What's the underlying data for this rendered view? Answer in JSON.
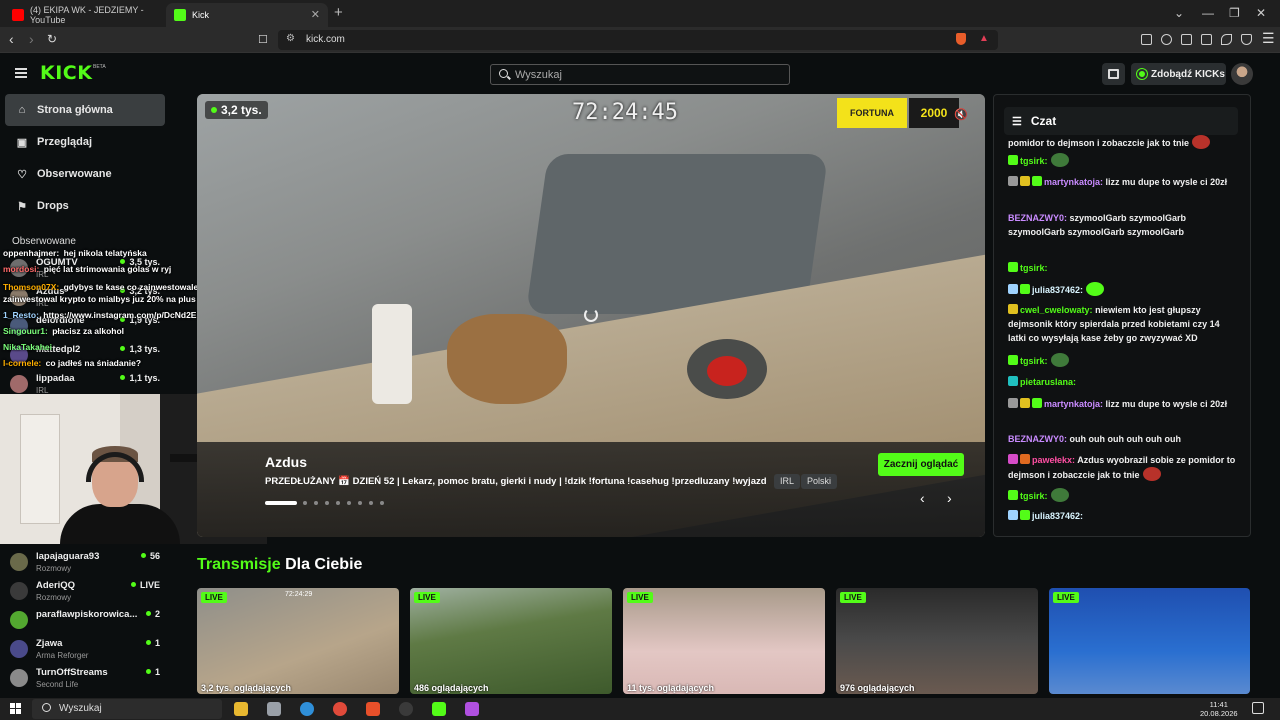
{
  "browser": {
    "tabs": [
      {
        "label": "(4) EKIPA WK - JEDZIEMY - YouTube"
      },
      {
        "label": "Kick"
      }
    ],
    "url": "kick.com"
  },
  "header": {
    "logo": "KICK",
    "beta": "BETA",
    "search_placeholder": "Wyszukaj",
    "kicks_button": "Zdobądź KICKs"
  },
  "sidebar": {
    "nav": [
      {
        "label": "Strona główna",
        "icon": "home-icon"
      },
      {
        "label": "Przeglądaj",
        "icon": "browse-icon"
      },
      {
        "label": "Obserwowane",
        "icon": "heart-icon"
      },
      {
        "label": "Drops",
        "icon": "drops-icon"
      }
    ],
    "followed_title": "Obserwowane",
    "channels_top": [
      {
        "name": "OGUMTV",
        "category": "IRL",
        "viewers": "3,5 tys."
      },
      {
        "name": "Azdus",
        "category": "IRL",
        "viewers": "3,2 tys."
      },
      {
        "name": "delordione",
        "category": "",
        "viewers": "1,9 tys."
      },
      {
        "name": "Mattedpl2",
        "category": "",
        "viewers": "1,3 tys."
      },
      {
        "name": "lippadaa",
        "category": "IRL",
        "viewers": "1,1 tys."
      }
    ],
    "channels_bottom": [
      {
        "name": "lapajaguara93",
        "category": "Rozmowy",
        "viewers": "56"
      },
      {
        "name": "AderiQQ",
        "category": "Rozmowy",
        "viewers": "LIVE"
      },
      {
        "name": "paraflawpiskorowica...",
        "category": "",
        "viewers": "2"
      },
      {
        "name": "Zjawa",
        "category": "Arma Reforger",
        "viewers": "1"
      },
      {
        "name": "TurnOffStreams",
        "category": "Second Life",
        "viewers": "1"
      }
    ]
  },
  "overlay_chat": [
    {
      "user": "oppenhajmer:",
      "text": "hej nikola telatyńska",
      "color": "#ffffff"
    },
    {
      "user": "mordosi:",
      "text": "pięć lat strimowania golas w ryj",
      "color": "#ff6b6b"
    },
    {
      "user": "Thomson07X:",
      "text": "gdybys te kase co zainwestowales yomis",
      "color": "#ffb000"
    },
    {
      "user": "",
      "text": "zainwestowal krypto to mialbys juz 20% na plus",
      "color": "#ffffff"
    },
    {
      "user": "1_Resto:",
      "text": "https://www.instagram.com/p/DcNd2EPq-82/",
      "color": "#9fd3ff"
    },
    {
      "user": "Singouur1:",
      "text": "płacisz za alkohol",
      "color": "#7cff7c"
    },
    {
      "user": "NikaTakahei",
      "text": "",
      "color": "#7cff7c"
    },
    {
      "user": "I-cornele:",
      "text": "co jadłeś na śniadanie?",
      "color": "#ffb000"
    }
  ],
  "hero": {
    "viewers": "3,2 tys.",
    "timer": "72:24:45",
    "sponsor": "FORTUNA",
    "sponsor_badge": "2000",
    "streamer": "Azdus",
    "title": "PRZEDŁUŻANY 📅 DZIEŃ 52 | Lekarz, pomoc bratu, gierki i nudy | !dzik !fortuna !casehug !przedluzany !wyjazd",
    "tags": [
      "IRL",
      "Polski"
    ],
    "watch_button": "Zacznij oglądać",
    "prev": "‹",
    "next": "›"
  },
  "chat": {
    "title": "Czat",
    "messages": [
      {
        "user": "",
        "text": "pomidor to dejmson i zobaczcie jak to tnie",
        "ucolor": "#ff4fa3"
      },
      {
        "user": "tgsirk:",
        "text": "",
        "ucolor": "#53fc18"
      },
      {
        "user": "martynkatoja:",
        "text": "lizz mu dupe to wysle ci 20zł",
        "ucolor": "#c98bff"
      },
      {
        "user": "BEZNAZWY0:",
        "text": "szymoolGarb szymoolGarb szymoolGarb szymoolGarb szymoolGarb",
        "ucolor": "#c98bff"
      },
      {
        "user": "tgsirk:",
        "text": "",
        "ucolor": "#53fc18"
      },
      {
        "user": "julia837462:",
        "text": "",
        "ucolor": "#d9f5ff"
      },
      {
        "user": "cwel_cwelowaty:",
        "text": "niewiem kto jest głupszy dejmsonik który spierdala przed kobietami czy 14 latki co wysyłają kase żeby go zwyzywać XD",
        "ucolor": "#53fc18"
      },
      {
        "user": "tgsirk:",
        "text": "",
        "ucolor": "#53fc18"
      },
      {
        "user": "pietaruslana:",
        "text": "",
        "ucolor": "#53fc18"
      },
      {
        "user": "martynkatoja:",
        "text": "lizz mu dupe to wysle ci 20zł",
        "ucolor": "#c98bff"
      },
      {
        "user": "BEZNAZWY0:",
        "text": "ouh ouh ouh ouh ouh ouh",
        "ucolor": "#c98bff"
      },
      {
        "user": "pawełekx:",
        "text": "Azdus wyobrazil sobie ze pomidor to dejmson i zobaczcie jak to tnie",
        "ucolor": "#ff4fa3"
      },
      {
        "user": "tgsirk:",
        "text": "",
        "ucolor": "#53fc18"
      },
      {
        "user": "julia837462:",
        "text": "",
        "ucolor": "#d9f5ff"
      }
    ]
  },
  "section": {
    "accent": "Transmisje",
    "rest": "Dla Ciebie"
  },
  "thumbnails": [
    {
      "live": "LIVE",
      "viewers": "3,2 tys. oglądających",
      "timer": "72:24:29"
    },
    {
      "live": "LIVE",
      "viewers": "486 oglądających"
    },
    {
      "live": "LIVE",
      "viewers": "11 tys. oglądających"
    },
    {
      "live": "LIVE",
      "viewers": "976 oglądających"
    },
    {
      "live": "LIVE",
      "viewers": ""
    }
  ],
  "taskbar": {
    "search": "Wyszukaj",
    "time": "11:41",
    "date": "20.08.2026"
  },
  "colors": {
    "accent": "#53fc18",
    "background": "#0b0e0f"
  }
}
